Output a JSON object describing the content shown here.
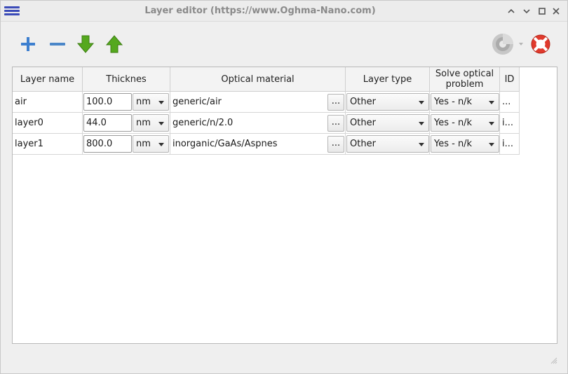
{
  "window": {
    "title": "Layer editor (https://www.Oghma-Nano.com)",
    "controls": [
      "minimize",
      "maximize",
      "restore",
      "close"
    ]
  },
  "toolbar": {
    "left_tools": [
      "add-icon",
      "remove-icon",
      "move-down-icon",
      "move-up-icon"
    ],
    "right_tools": [
      "render-icon",
      "help-icon"
    ]
  },
  "table": {
    "headers": [
      "Layer name",
      "Thicknes",
      "Optical material",
      "Layer type",
      "Solve optical problem",
      "ID"
    ],
    "rows": [
      {
        "name": "air",
        "thickness": "100.0",
        "unit": "nm",
        "material": "generic/air",
        "material_btn": "...",
        "layer_type": "Other",
        "solve_optical": "Yes - n/k",
        "id": "..."
      },
      {
        "name": "layer0",
        "thickness": "44.0",
        "unit": "nm",
        "material": "generic/n/2.0",
        "material_btn": "...",
        "layer_type": "Other",
        "solve_optical": "Yes - n/k",
        "id": "i..."
      },
      {
        "name": "layer1",
        "thickness": "800.0",
        "unit": "nm",
        "material": "inorganic/GaAs/Aspnes",
        "material_btn": "...",
        "layer_type": "Other",
        "solve_optical": "Yes - n/k",
        "id": "i..."
      }
    ]
  },
  "colors": {
    "add": "#3d7fcf",
    "remove": "#4a86c8",
    "arrow_green": "#55a81e",
    "help_red": "#e03a2d",
    "menu_blue": "#3b4bb8"
  }
}
